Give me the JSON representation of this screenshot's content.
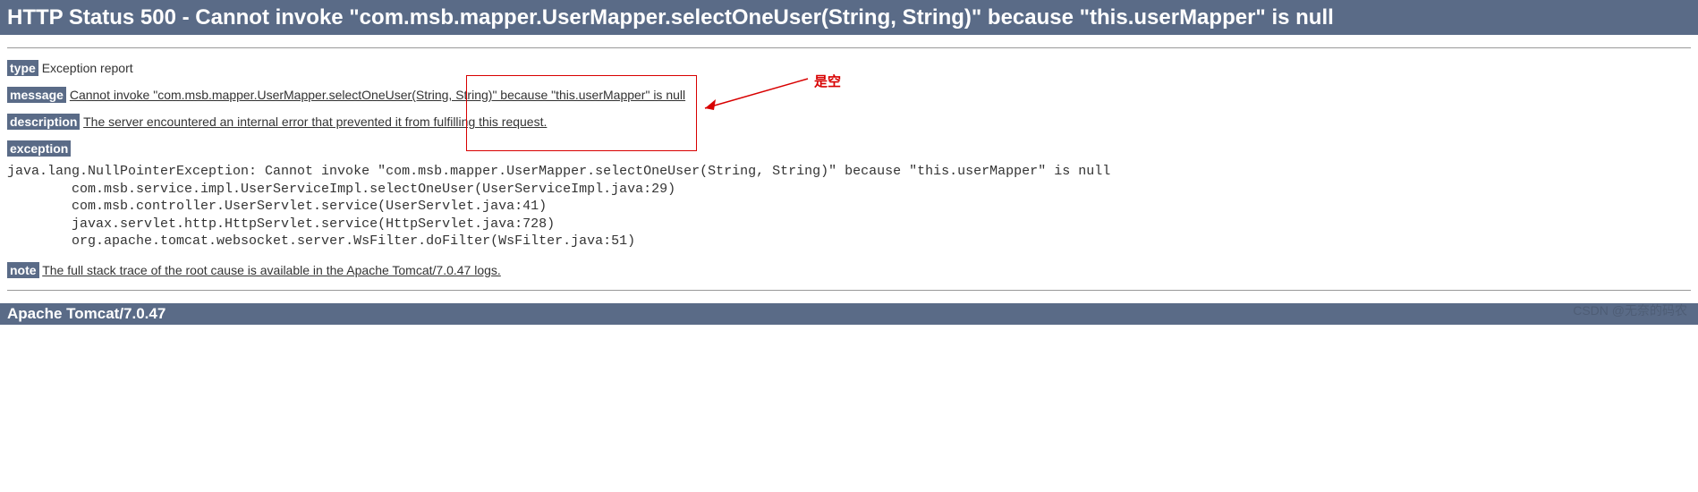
{
  "header": {
    "title": "HTTP Status 500 - Cannot invoke \"com.msb.mapper.UserMapper.selectOneUser(String, String)\" because \"this.userMapper\" is null"
  },
  "sections": {
    "type": {
      "label": "type",
      "text": "Exception report"
    },
    "message": {
      "label": "message",
      "text": "Cannot invoke \"com.msb.mapper.UserMapper.selectOneUser(String, String)\" because \"this.userMapper\" is null"
    },
    "description": {
      "label": "description",
      "text": "The server encountered an internal error that prevented it from fulfilling this request."
    },
    "exception": {
      "label": "exception"
    },
    "note": {
      "label": "note",
      "text": "The full stack trace of the root cause is available in the Apache Tomcat/7.0.47 logs."
    }
  },
  "stack_trace": "java.lang.NullPointerException: Cannot invoke \"com.msb.mapper.UserMapper.selectOneUser(String, String)\" because \"this.userMapper\" is null\n\tcom.msb.service.impl.UserServiceImpl.selectOneUser(UserServiceImpl.java:29)\n\tcom.msb.controller.UserServlet.service(UserServlet.java:41)\n\tjavax.servlet.http.HttpServlet.service(HttpServlet.java:728)\n\torg.apache.tomcat.websocket.server.WsFilter.doFilter(WsFilter.java:51)",
  "footer": {
    "text": "Apache Tomcat/7.0.47"
  },
  "annotation": {
    "text": "是空"
  },
  "watermark": "CSDN @无奈的码农"
}
